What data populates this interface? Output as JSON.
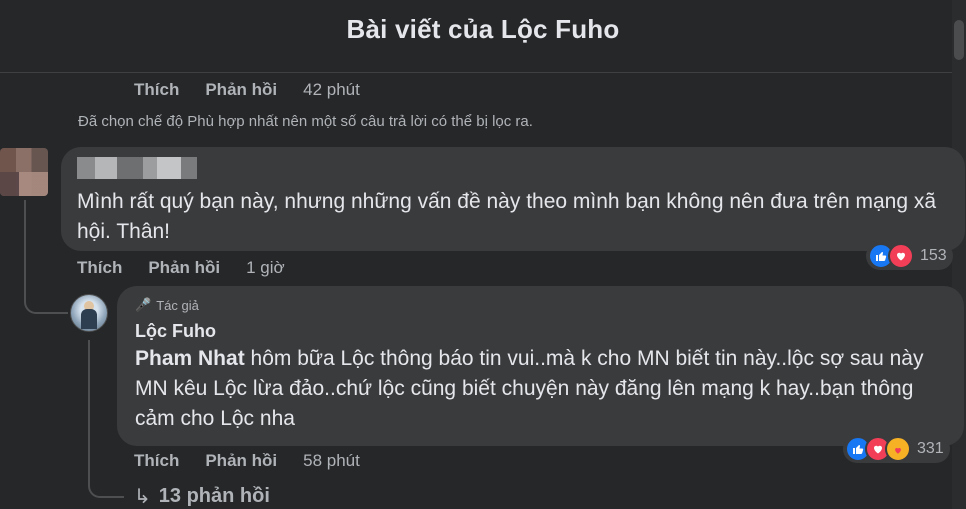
{
  "header": {
    "title": "Bài viết của Lộc Fuho"
  },
  "prev_comment_actions": {
    "like": "Thích",
    "reply": "Phản hồi",
    "time": "42 phút"
  },
  "filter_note": "Đã chọn chế độ Phù hợp nhất nên một số câu trả lời có thể bị lọc ra.",
  "comment": {
    "text": "Mình rất quý bạn này, nhưng những vấn đề này theo mình bạn không nên đưa trên mạng xã hội. Thân!",
    "reactions": {
      "icons": [
        "like-icon",
        "love-icon"
      ],
      "count": "153"
    },
    "actions": {
      "like": "Thích",
      "reply": "Phản hồi",
      "time": "1 giờ"
    }
  },
  "reply": {
    "badge": "Tác giả",
    "author": "Lộc Fuho",
    "mention": "Pham Nhat",
    "text": " hôm bữa Lộc thông báo tin vui..mà k cho MN biết tin này..lộc sợ sau này MN kêu Lộc lừa đảo..chứ lộc cũng biết chuyện này đăng lên mạng k hay..bạn thông cảm cho Lộc nha",
    "reactions": {
      "icons": [
        "like-icon",
        "love-icon",
        "care-icon"
      ],
      "count": "331"
    },
    "actions": {
      "like": "Thích",
      "reply": "Phản hồi",
      "time": "58 phút"
    }
  },
  "more_replies": {
    "arrow": "↳",
    "label": "13 phản hồi"
  },
  "colors": {
    "background": "#252728",
    "bubble": "#3a3b3c",
    "like": "#1877f2",
    "love": "#f33e58",
    "care": "#f7b125"
  }
}
